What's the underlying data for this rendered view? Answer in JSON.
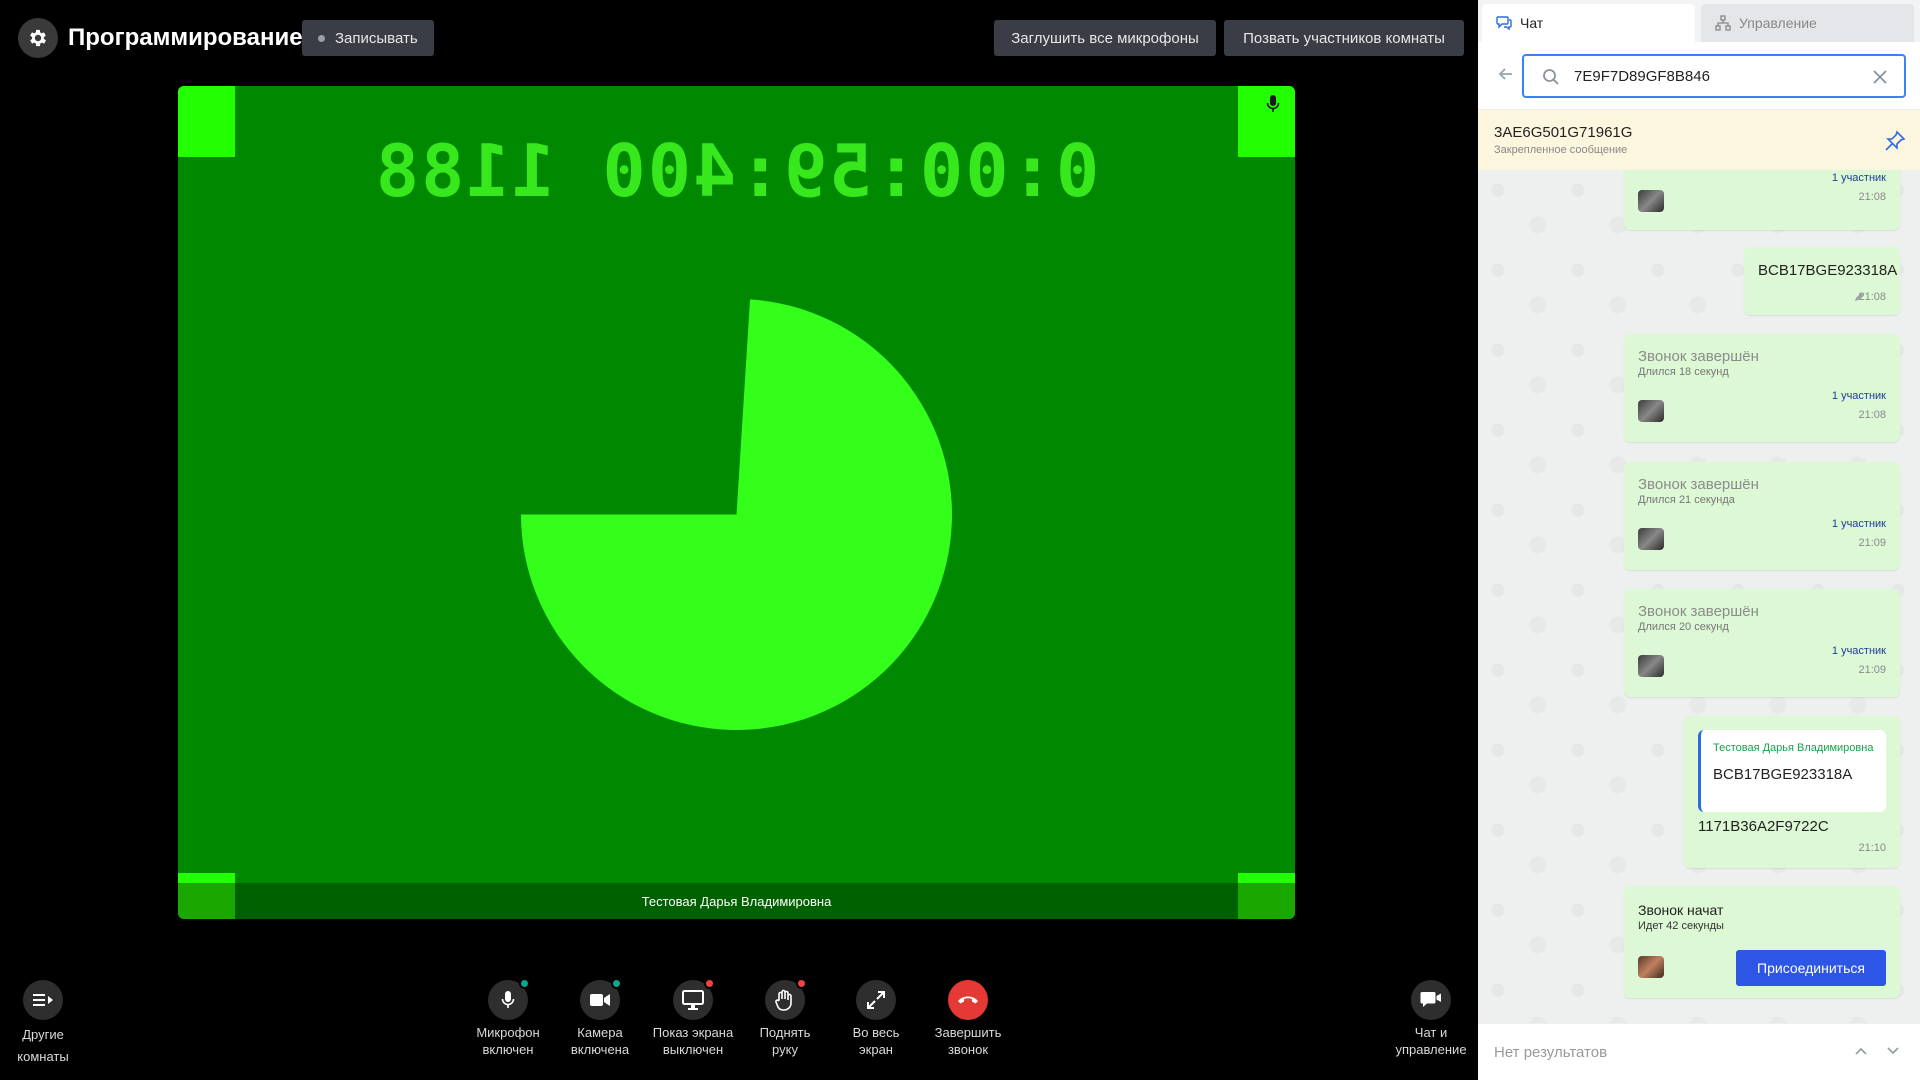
{
  "header": {
    "title": "Программирование 1",
    "record_label": "Записывать",
    "mute_all_label": "Заглушить все микрофоны",
    "invite_label": "Позвать участников комнаты"
  },
  "video": {
    "timecode": "0:00:59:400 1188",
    "participant_name": "Тестовая Дарья Владимировна",
    "pie_fraction": 0.74,
    "colors": {
      "background": "#008800",
      "foreground": "#33ff1a"
    }
  },
  "controls": {
    "other_rooms": "Другие комнаты",
    "mic": "Микрофон включен",
    "camera": "Камера включена",
    "screen": "Показ экрана выключен",
    "hand": "Поднять руку",
    "fullscreen": "Во весь экран",
    "end_call": "Завершить звонок",
    "chat_control": "Чат и управление"
  },
  "panel": {
    "tab_chat": "Чат",
    "tab_manage": "Управление",
    "search_value": "7E9F7D89GF8B846",
    "pinned_title": "3AE6G501G71961G",
    "pinned_sub": "Закрепленное сообщение",
    "no_results": "Нет результатов"
  },
  "messages": {
    "m0": {
      "participants": "1 участник",
      "time": "21:08"
    },
    "m1": {
      "text": "BCB17BGE923318A",
      "time": "21:08"
    },
    "m2": {
      "title": "Звонок завершён",
      "sub": "Длился 18 секунд",
      "participants": "1 участник",
      "time": "21:08"
    },
    "m3": {
      "title": "Звонок завершён",
      "sub": "Длился 21 секунда",
      "participants": "1 участник",
      "time": "21:09"
    },
    "m4": {
      "title": "Звонок завершён",
      "sub": "Длился 20 секунд",
      "participants": "1 участник",
      "time": "21:09"
    },
    "m5": {
      "quote_author": "Тестовая Дарья Владимировна",
      "quote_text": "BCB17BGE923318A",
      "text": "1171B36A2F9722C",
      "time": "21:10"
    },
    "m6": {
      "title": "Звонок начат",
      "sub": "Идет 42 секунды",
      "join_label": "Присоединиться"
    }
  }
}
